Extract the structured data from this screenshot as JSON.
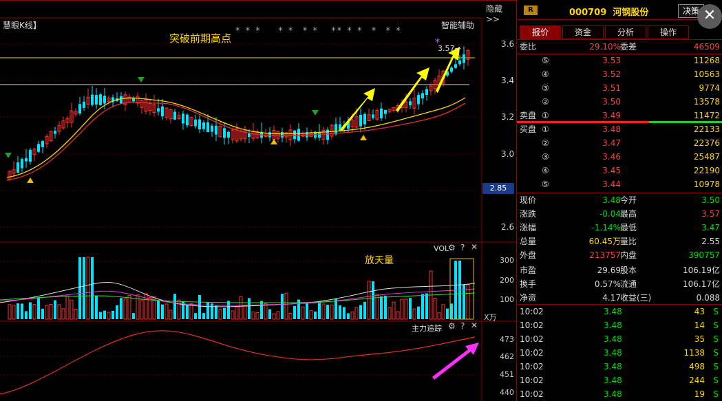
{
  "window": {
    "hide_label": "隐藏>>"
  },
  "main_chart": {
    "title": "慧眼K线】",
    "indicator_label": "智能辅助",
    "annotation": "突破前期高点",
    "stars": "* * *    * *  * *   ** * *  *  * *",
    "last_marker": "3.57",
    "y_ticks": [
      "3.6",
      "3.4",
      "3.2",
      "3.0",
      "2.6"
    ],
    "current_price_badge": "2.85"
  },
  "vol_chart": {
    "title": "VOL",
    "annotation": "放天量",
    "y_ticks": [
      "300",
      "200",
      "100"
    ],
    "unit": "X万"
  },
  "trend_chart": {
    "title": "主力追踪",
    "y_ticks": [
      "473",
      "462",
      "451",
      "440"
    ]
  },
  "panel": {
    "badge": "R",
    "code": "000709",
    "name": "河钢股份",
    "decision_label": "决策",
    "close_symbol": "✕",
    "tabs": [
      "报价",
      "资金",
      "分析",
      "操作"
    ],
    "weibi": {
      "label": "委比",
      "value": "29.10%",
      "label2": "委差",
      "value2": "46509"
    },
    "sells": [
      {
        "label": "",
        "idx": "⑤",
        "price": "3.53",
        "vol": "11268"
      },
      {
        "label": "",
        "idx": "④",
        "price": "3.52",
        "vol": "10563"
      },
      {
        "label": "",
        "idx": "③",
        "price": "3.51",
        "vol": "9774"
      },
      {
        "label": "",
        "idx": "②",
        "price": "3.50",
        "vol": "13578"
      },
      {
        "label": "卖盘",
        "idx": "①",
        "price": "3.49",
        "vol": "11472"
      }
    ],
    "buys": [
      {
        "label": "买盘",
        "idx": "①",
        "price": "3.48",
        "vol": "22133"
      },
      {
        "label": "",
        "idx": "②",
        "price": "3.47",
        "vol": "22376"
      },
      {
        "label": "",
        "idx": "③",
        "price": "3.46",
        "vol": "25487"
      },
      {
        "label": "",
        "idx": "④",
        "price": "3.45",
        "vol": "22190"
      },
      {
        "label": "",
        "idx": "⑤",
        "price": "3.44",
        "vol": "10978"
      }
    ],
    "quote": [
      {
        "l1": "现价",
        "v1": "3.48",
        "l2": "今开",
        "v2": "3.50"
      },
      {
        "l1": "涨跌",
        "v1": "-0.04",
        "l2": "最高",
        "v2": "3.57"
      },
      {
        "l1": "涨幅",
        "v1": "-1.14%",
        "l2": "最低",
        "v2": "3.47"
      },
      {
        "l1": "总量",
        "v1": "60.45万",
        "l2": "量比",
        "v2": "2.55"
      },
      {
        "l1": "外盘",
        "v1": "213757",
        "l2": "内盘",
        "v2": "390757"
      },
      {
        "l1": "市盈",
        "v1": "29.69",
        "l2": "股本",
        "v2": "106.19亿"
      },
      {
        "l1": "换手",
        "v1": "0.57%",
        "l2": "流通",
        "v2": "106.17亿"
      },
      {
        "l1": "净资",
        "v1": "4.17",
        "l2": "收益(三)",
        "v2": "0.088"
      }
    ],
    "ticks": [
      {
        "time": "10:02",
        "price": "3.48",
        "vol": "43",
        "side": "S"
      },
      {
        "time": "10:02",
        "price": "3.48",
        "vol": "14",
        "side": "S"
      },
      {
        "time": "10:02",
        "price": "3.48",
        "vol": "35",
        "side": "S"
      },
      {
        "time": "10:02",
        "price": "3.48",
        "vol": "1138",
        "side": "S"
      },
      {
        "time": "10:02",
        "price": "3.48",
        "vol": "498",
        "side": "S"
      },
      {
        "time": "10:02",
        "price": "3.48",
        "vol": "244",
        "side": "S"
      },
      {
        "time": "10:02",
        "price": "3.48",
        "vol": "19",
        "side": "S"
      }
    ]
  },
  "colors": {
    "up": "#ff3030",
    "down": "#00e5ff",
    "accent": "#ffd700",
    "border": "#8b0000"
  }
}
